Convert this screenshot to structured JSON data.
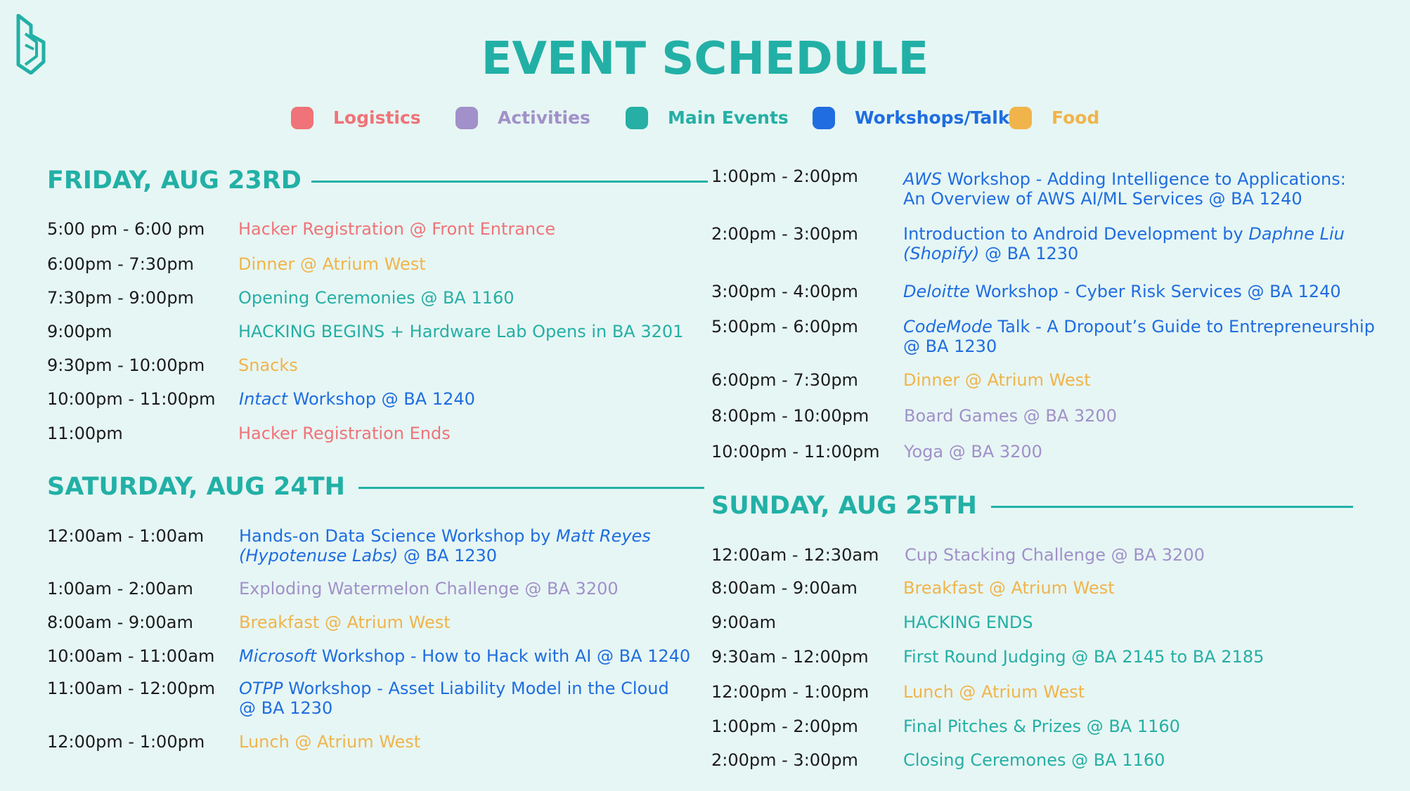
{
  "header": {
    "title": "EVENT SCHEDULE"
  },
  "colors": {
    "logistics": "#ef7378",
    "activities": "#a190c9",
    "main_events": "#25afa5",
    "workshops_talks": "#1f6de0",
    "food": "#f0b44b",
    "accent": "#22b0a6",
    "background": "#e6f6f4"
  },
  "legend": [
    {
      "label": "Logistics",
      "color": "#ef7378"
    },
    {
      "label": "Activities",
      "color": "#a190c9"
    },
    {
      "label": "Main Events",
      "color": "#25afa5"
    },
    {
      "label": "Workshops/Talks",
      "color": "#1f6de0"
    },
    {
      "label": "Food",
      "color": "#f0b44b"
    }
  ],
  "days": {
    "friday": {
      "title": "FRIDAY, AUG 23RD",
      "events": [
        {
          "time": "5:00 pm - 6:00 pm",
          "desc": "Hacker Registration @ Front Entrance"
        },
        {
          "time": "6:00pm - 7:30pm",
          "desc": "Dinner @ Atrium West"
        },
        {
          "time": "7:30pm - 9:00pm",
          "desc": "Opening Ceremonies @ BA 1160"
        },
        {
          "time": "9:00pm",
          "desc": "HACKING BEGINS + Hardware Lab Opens in BA 3201"
        },
        {
          "time": "9:30pm - 10:00pm",
          "desc": "Snacks"
        },
        {
          "time": "10:00pm - 11:00pm",
          "sponsor": "Intact",
          "desc": " Workshop @ BA 1240"
        },
        {
          "time": "11:00pm",
          "desc": "Hacker Registration Ends"
        }
      ]
    },
    "saturday": {
      "title": "SATURDAY, AUG 24TH",
      "events": [
        {
          "time": "12:00am - 1:00am",
          "desc_a": "Hands-on Data Science Workshop by ",
          "speaker_a": "Matt Reyes",
          "speaker_b": "(Hypotenuse Labs)",
          "desc_b": " @ BA 1230"
        },
        {
          "time": "1:00am - 2:00am",
          "desc": "Exploding Watermelon Challenge @ BA 3200"
        },
        {
          "time": "8:00am - 9:00am",
          "desc": "Breakfast @ Atrium West"
        },
        {
          "time": "10:00am - 11:00am",
          "sponsor": "Microsoft",
          "desc": " Workshop - How to Hack with AI @ BA 1240"
        },
        {
          "time": "11:00am - 12:00pm",
          "sponsor": "OTPP",
          "desc_a": " Workshop - Asset Liability Model in the Cloud",
          "desc_b": "@ BA 1230"
        },
        {
          "time": "12:00pm - 1:00pm",
          "desc": "Lunch @ Atrium West"
        }
      ],
      "continued": [
        {
          "time": "1:00pm - 2:00pm",
          "sponsor": "AWS",
          "desc_a": " Workshop - Adding Intelligence to Applications:",
          "desc_b": "An Overview of AWS AI/ML Services @  BA 1240"
        },
        {
          "time": "2:00pm - 3:00pm",
          "desc_a": "Introduction to Android Development by ",
          "speaker_a": "Daphne Liu",
          "speaker_b": "(Shopify)",
          "desc_b": " @ BA 1230"
        },
        {
          "time": "3:00pm - 4:00pm",
          "sponsor": "Deloitte",
          "desc": " Workshop - Cyber Risk Services @ BA 1240"
        },
        {
          "time": "5:00pm - 6:00pm",
          "sponsor": "CodeMode",
          "desc_a": " Talk - A Dropout’s Guide to Entrepreneurship",
          "desc_b": "@ BA 1230"
        },
        {
          "time": "6:00pm - 7:30pm",
          "desc": "Dinner @ Atrium West"
        },
        {
          "time": "8:00pm - 10:00pm",
          "desc": "Board Games @ BA 3200"
        },
        {
          "time": "10:00pm - 11:00pm",
          "desc": "Yoga @ BA 3200"
        }
      ]
    },
    "sunday": {
      "title": "SUNDAY, AUG 25TH",
      "events": [
        {
          "time": "12:00am - 12:30am",
          "desc": "Cup Stacking Challenge @ BA 3200"
        },
        {
          "time": "8:00am - 9:00am",
          "desc": "Breakfast @ Atrium West"
        },
        {
          "time": "9:00am",
          "desc": "HACKING ENDS"
        },
        {
          "time": "9:30am - 12:00pm",
          "desc": "First Round Judging @ BA 2145 to BA 2185"
        },
        {
          "time": "12:00pm - 1:00pm",
          "desc": "Lunch @ Atrium West"
        },
        {
          "time": "1:00pm - 2:00pm",
          "desc": "Final Pitches & Prizes @ BA 1160"
        },
        {
          "time": "2:00pm - 3:00pm",
          "desc": "Closing Ceremones @ BA 1160"
        }
      ]
    }
  }
}
